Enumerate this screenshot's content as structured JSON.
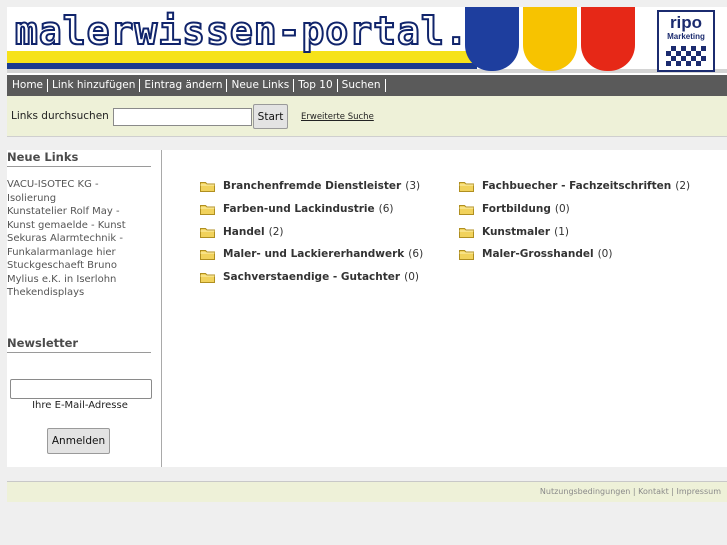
{
  "banner": {
    "site_name": "malerwissen-portal.de",
    "logo_brand": "ripo",
    "logo_sub": "Marketing"
  },
  "nav": {
    "items": [
      "Home",
      "Link hinzufügen",
      "Eintrag ändern",
      "Neue Links",
      "Top 10",
      "Suchen"
    ]
  },
  "search": {
    "label": "Links durchsuchen",
    "value": "",
    "button": "Start",
    "advanced": "Erweiterte Suche"
  },
  "sidebar": {
    "new_links_title": "Neue Links",
    "new_links": [
      "VACU-ISOTEC KG -",
      "Isolierung",
      "Kunstatelier Rolf May -",
      "Kunst gemaelde - Kunst",
      "Sekuras Alarmtechnik -",
      "Funkalarmanlage hier",
      "Stuckgeschaeft Bruno",
      "Mylius e.K. in Iserlohn",
      "Thekendisplays"
    ],
    "newsletter_title": "Newsletter",
    "email_label": "Ihre E-Mail-Adresse",
    "subscribe_button": "Anmelden"
  },
  "categories": [
    {
      "name": "Branchenfremde Dienstleister",
      "count": "(3)"
    },
    {
      "name": "Farben-und Lackindustrie",
      "count": "(6)"
    },
    {
      "name": "Handel",
      "count": "(2)"
    },
    {
      "name": "Maler- und Lackiererhandwerk",
      "count": "(6)"
    },
    {
      "name": "Sachverstaendige - Gutachter",
      "count": "(0)"
    },
    {
      "name": "Fachbuecher - Fachzeitschriften",
      "count": "(2)"
    },
    {
      "name": "Fortbildung",
      "count": "(0)"
    },
    {
      "name": "Kunstmaler",
      "count": "(1)"
    },
    {
      "name": "Maler-Grosshandel",
      "count": "(0)"
    }
  ],
  "footer": {
    "links": [
      "Nutzungsbedingungen",
      "Kontakt",
      "Impressum"
    ],
    "separator": " | "
  },
  "colors": {
    "nav_bg": "#5a5a5a",
    "search_bg": "#eef1d8",
    "folder": "#f1d25c"
  }
}
